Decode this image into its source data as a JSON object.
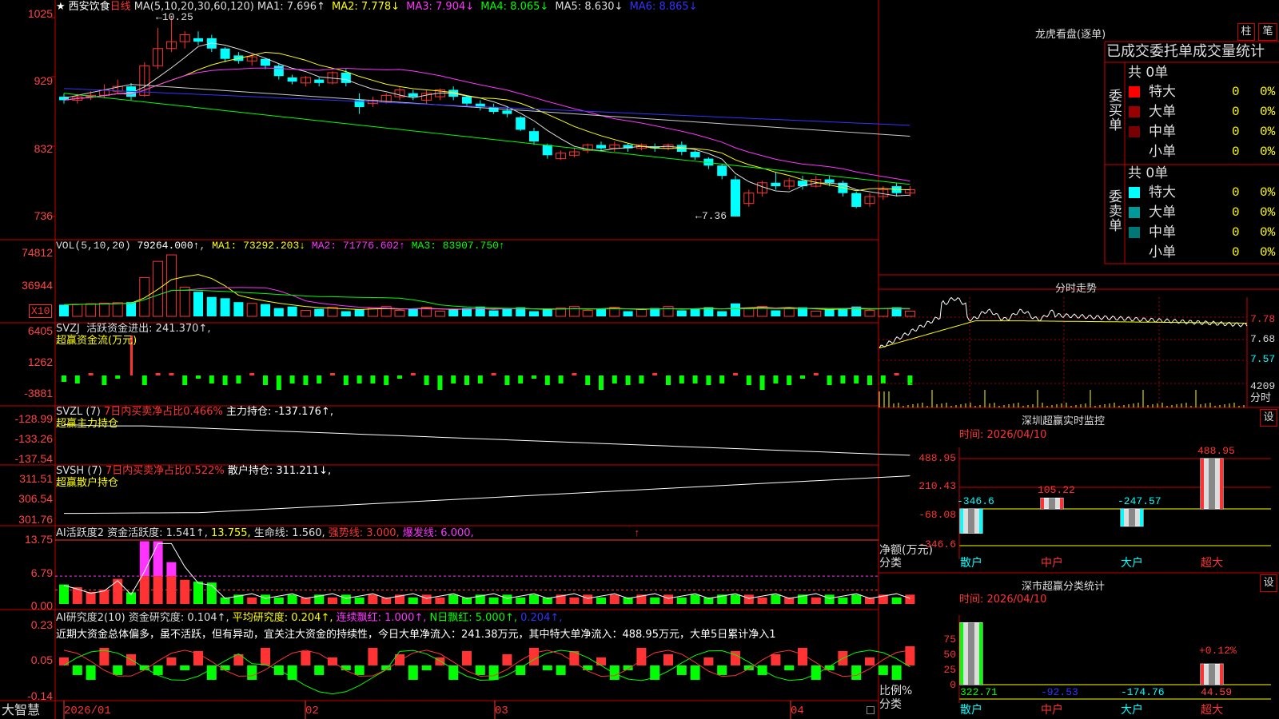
{
  "stock": {
    "star": "★",
    "name": "西安饮食",
    "period": "日线"
  },
  "ma_header": {
    "label": "MA(5,10,20,30,60,120)",
    "items": [
      {
        "t": "MA1: 7.696↑",
        "c": "#ddd"
      },
      {
        "t": "MA2: 7.778↓",
        "c": "#ff0"
      },
      {
        "t": "MA3: 7.904↓",
        "c": "#f3f"
      },
      {
        "t": "MA4: 8.065↓",
        "c": "#0f0"
      },
      {
        "t": "MA5: 8.630↓",
        "c": "#ddd"
      },
      {
        "t": "MA6: 8.865↓",
        "c": "#33f"
      }
    ]
  },
  "price_axis": [
    "1025",
    "929",
    "832",
    "736"
  ],
  "price_high": "10.25",
  "price_low": "7.36",
  "vol_header": {
    "label": "VOL(5,10,20)",
    "value": "79264.000↑",
    "items": [
      {
        "t": "MA1: 73292.203↓",
        "c": "#ff0"
      },
      {
        "t": "MA2: 71776.602↑",
        "c": "#f3f"
      },
      {
        "t": "MA3: 83907.750↑",
        "c": "#0f0"
      }
    ]
  },
  "vol_axis": [
    "74812",
    "36944"
  ],
  "vol_unit": "X10",
  "svzj": {
    "label": "SVZJ",
    "title": "活跃资金进出: 241.370↑,",
    "sub": "超赢资金流(万元)",
    "axis": [
      "6405",
      "1262",
      "-3881"
    ]
  },
  "svzl": {
    "label": "SVZL (7)",
    "ratio": "7日内买卖净占比0.466%",
    "hold": "主力持仓: -137.176↑,",
    "sub": "超赢主力持仓",
    "axis": [
      "-128.99",
      "-133.26",
      "-137.54"
    ]
  },
  "svsh": {
    "label": "SVSH (7)",
    "ratio": "7日内买卖净占比0.522%",
    "hold": "散户持仓: 311.211↓,",
    "sub": "超赢散户持仓",
    "axis": [
      "311.51",
      "306.54",
      "301.76"
    ]
  },
  "ai1": {
    "label": "AI活跃度2",
    "items": [
      {
        "t": "资金活跃度: 1.541↑,",
        "c": "#ddd"
      },
      {
        "t": "13.755,",
        "c": "#ff0"
      },
      {
        "t": "生命线: 1.560,",
        "c": "#ddd"
      },
      {
        "t": "强势线: 3.000,",
        "c": "#f33"
      },
      {
        "t": "爆发线: 6.000,",
        "c": "#f3f"
      }
    ],
    "axis": [
      "13.75",
      "6.79",
      "0.00"
    ],
    "arrow": "↑"
  },
  "ai2": {
    "label": "AI研究度2(10)",
    "items": [
      {
        "t": "资金研究度: 0.104↑,",
        "c": "#ddd"
      },
      {
        "t": "平均研究度: 0.204↑,",
        "c": "#ff0"
      },
      {
        "t": "连续飘红: 1.000↑,",
        "c": "#f3f"
      },
      {
        "t": "N日飘红: 5.000↑,",
        "c": "#0f0"
      },
      {
        "t": "0.204↑,",
        "c": "#33f"
      }
    ],
    "comment": "近期大资金总体偏多，虽不活跃，但有异动，宜关注大资金的持续性，今日大单净流入：241.38万元，其中特大单净流入：488.95万元，大单5日累计净入1",
    "axis": [
      "0.23",
      "0.05",
      "-0.14"
    ]
  },
  "dates": [
    "2026/01",
    "02",
    "03",
    "04"
  ],
  "brand": "大智慧",
  "right": {
    "dragon_title": "龙虎看盘(逐单)",
    "btn_zhu": "柱",
    "btn_bi": "笔",
    "stat_title": "已成交委托单成交量统计",
    "buy": {
      "side": "委买单",
      "total": "共 0单",
      "rows": [
        {
          "label": "特大",
          "val": "0",
          "pct": "0%",
          "color": "#f00"
        },
        {
          "label": "大单",
          "val": "0",
          "pct": "0%",
          "color": "#900"
        },
        {
          "label": "中单",
          "val": "0",
          "pct": "0%",
          "color": "#700"
        },
        {
          "label": "小单",
          "val": "0",
          "pct": "0%",
          "color": ""
        }
      ]
    },
    "sell": {
      "side": "委卖单",
      "total": "共 0单",
      "rows": [
        {
          "label": "特大",
          "val": "0",
          "pct": "0%",
          "color": "#0ff"
        },
        {
          "label": "大单",
          "val": "0",
          "pct": "0%",
          "color": "#099"
        },
        {
          "label": "中单",
          "val": "0",
          "pct": "0%",
          "color": "#077"
        },
        {
          "label": "小单",
          "val": "0",
          "pct": "0%",
          "color": ""
        }
      ]
    },
    "intraday": {
      "title": "分时走势",
      "axis": [
        "7.78",
        "7.68",
        "7.57",
        "4209"
      ],
      "unit": "分时"
    },
    "sz_monitor": {
      "title": "深圳超赢实时监控",
      "btn": "设",
      "date": "时间: 2026/04/10",
      "axis": [
        "488.95",
        "210.43",
        "-68.08",
        "-346.6"
      ],
      "unit": "净额(万元)",
      "cat_label": "分类",
      "bars": [
        {
          "cat": "散户",
          "v": -346.6,
          "label": "-346.6"
        },
        {
          "cat": "中户",
          "v": 105.22,
          "label": "105.22"
        },
        {
          "cat": "大户",
          "v": -247.57,
          "label": "-247.57"
        },
        {
          "cat": "超大",
          "v": 488.95,
          "label": "488.95"
        }
      ]
    },
    "sz_stat": {
      "title": "深市超赢分类统计",
      "btn": "设",
      "date": "时间: 2026/04/10",
      "axis": [
        "75",
        "50",
        "25",
        "0"
      ],
      "unit": "比例%",
      "cat_label": "分类",
      "pct_label": "+0.12%",
      "bars": [
        {
          "cat": "散户",
          "v": 85,
          "label": "322.71",
          "c": "#0f0"
        },
        {
          "cat": "中户",
          "v": 0,
          "label": "-92.53",
          "c": "#33f"
        },
        {
          "cat": "大户",
          "v": 0,
          "label": "-174.76",
          "c": "#0ff"
        },
        {
          "cat": "超大",
          "v": 34,
          "label": "44.59",
          "c": "#f44"
        }
      ]
    }
  },
  "chart_data": {
    "type": "candlestick",
    "candles": [
      [
        9.1,
        9.05,
        9.15,
        9.0
      ],
      [
        9.05,
        9.1,
        9.14,
        9.0
      ],
      [
        9.1,
        9.12,
        9.18,
        9.05
      ],
      [
        9.12,
        9.2,
        9.28,
        9.08
      ],
      [
        9.18,
        9.25,
        9.35,
        9.15
      ],
      [
        9.25,
        9.1,
        9.3,
        9.05
      ],
      [
        9.12,
        9.55,
        9.6,
        9.1
      ],
      [
        9.55,
        9.8,
        10.1,
        9.5
      ],
      [
        9.8,
        9.9,
        10.25,
        9.75
      ],
      [
        9.9,
        10.0,
        10.05,
        9.8
      ],
      [
        9.95,
        9.9,
        10.05,
        9.85
      ],
      [
        9.95,
        9.8,
        10.0,
        9.75
      ],
      [
        9.8,
        9.65,
        9.82,
        9.6
      ],
      [
        9.7,
        9.62,
        9.75,
        9.58
      ],
      [
        9.62,
        9.68,
        9.72,
        9.55
      ],
      [
        9.65,
        9.55,
        9.66,
        9.5
      ],
      [
        9.55,
        9.4,
        9.58,
        9.35
      ],
      [
        9.38,
        9.32,
        9.42,
        9.28
      ],
      [
        9.3,
        9.38,
        9.4,
        9.25
      ],
      [
        9.35,
        9.3,
        9.38,
        9.25
      ],
      [
        9.3,
        9.45,
        9.47,
        9.28
      ],
      [
        9.45,
        9.3,
        9.5,
        9.25
      ],
      [
        9.05,
        8.95,
        9.15,
        8.85
      ],
      [
        9.0,
        9.05,
        9.1,
        8.95
      ],
      [
        9.02,
        9.12,
        9.15,
        9.0
      ],
      [
        9.1,
        9.2,
        9.25,
        9.05
      ],
      [
        9.15,
        9.1,
        9.2,
        9.05
      ],
      [
        9.05,
        9.15,
        9.2,
        9.0
      ],
      [
        9.1,
        9.2,
        9.22,
        9.05
      ],
      [
        9.2,
        9.1,
        9.25,
        9.05
      ],
      [
        9.1,
        9.0,
        9.12,
        8.95
      ],
      [
        9.0,
        8.95,
        9.05,
        8.9
      ],
      [
        8.95,
        8.88,
        9.0,
        8.85
      ],
      [
        8.9,
        8.85,
        8.95,
        8.8
      ],
      [
        8.8,
        8.62,
        8.82,
        8.6
      ],
      [
        8.6,
        8.45,
        8.65,
        8.4
      ],
      [
        8.4,
        8.25,
        8.42,
        8.2
      ],
      [
        8.2,
        8.28,
        8.32,
        8.18
      ],
      [
        8.25,
        8.3,
        8.35,
        8.22
      ],
      [
        8.32,
        8.4,
        8.42,
        8.28
      ],
      [
        8.4,
        8.35,
        8.45,
        8.3
      ],
      [
        8.35,
        8.4,
        8.45,
        8.3
      ],
      [
        8.4,
        8.35,
        8.42,
        8.3
      ],
      [
        8.35,
        8.4,
        8.42,
        8.32
      ],
      [
        8.38,
        8.35,
        8.42,
        8.3
      ],
      [
        8.35,
        8.4,
        8.42,
        8.32
      ],
      [
        8.4,
        8.3,
        8.45,
        8.25
      ],
      [
        8.3,
        8.22,
        8.32,
        8.18
      ],
      [
        8.2,
        8.1,
        8.22,
        8.05
      ],
      [
        8.1,
        7.95,
        8.12,
        7.9
      ],
      [
        7.9,
        7.36,
        7.95,
        7.36
      ],
      [
        7.55,
        7.7,
        7.75,
        7.5
      ],
      [
        7.7,
        7.85,
        7.88,
        7.65
      ],
      [
        7.85,
        7.8,
        8.0,
        7.75
      ],
      [
        7.8,
        7.88,
        7.92,
        7.75
      ],
      [
        7.88,
        7.8,
        7.95,
        7.75
      ],
      [
        7.8,
        7.9,
        7.95,
        7.78
      ],
      [
        7.9,
        7.85,
        7.95,
        7.8
      ],
      [
        7.85,
        7.7,
        7.88,
        7.65
      ],
      [
        7.7,
        7.5,
        7.72,
        7.48
      ],
      [
        7.55,
        7.65,
        7.7,
        7.5
      ],
      [
        7.65,
        7.75,
        7.8,
        7.6
      ],
      [
        7.8,
        7.7,
        7.85,
        7.65
      ],
      [
        7.7,
        7.75,
        7.8,
        7.65
      ]
    ]
  }
}
